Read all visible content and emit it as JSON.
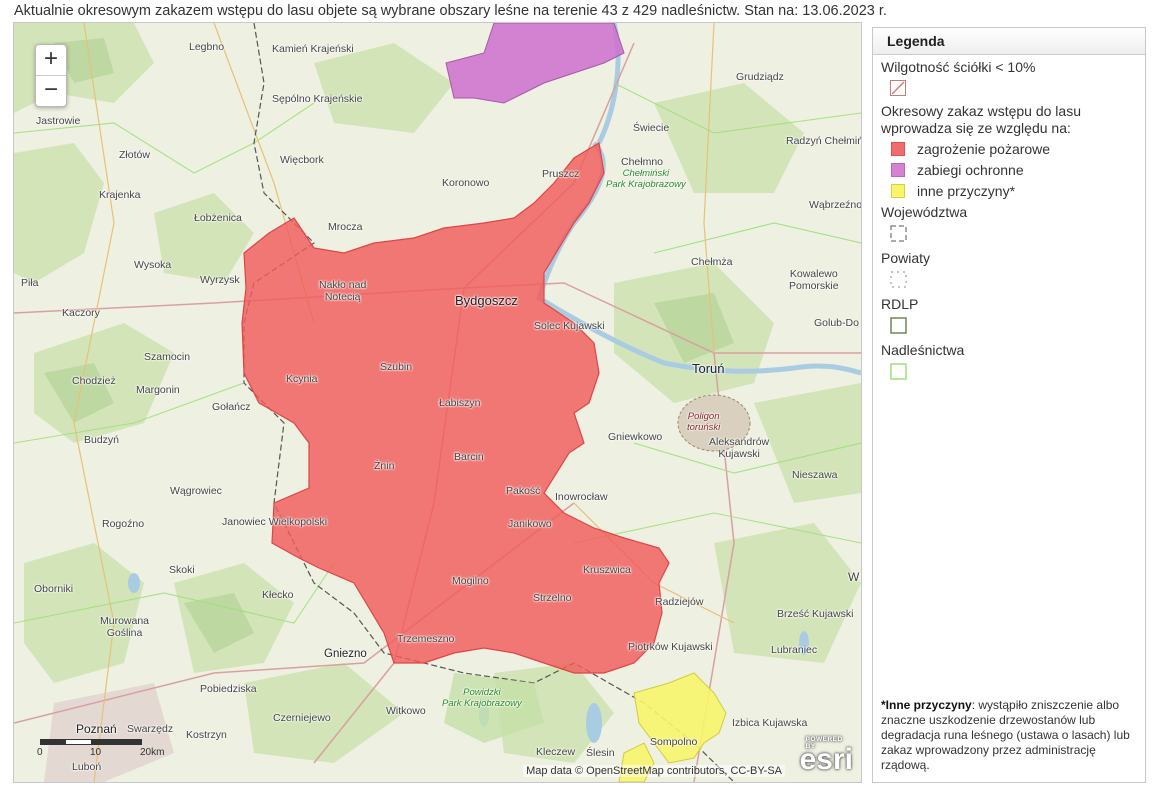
{
  "header": {
    "text": "Aktualnie okresowym zakazem wstępu do lasu objete są wybrane obszary leśne na terenie 43 z 429 nadleśnictw. Stan na: 13.06.2023 r."
  },
  "map": {
    "zoom_in": "+",
    "zoom_out": "−",
    "places": {
      "legbno": "Legbno",
      "kamien": "Kamień Krajeński",
      "sepolno": "Sępólno Krajeńskie",
      "jastrowie": "Jastrowie",
      "wiecbork": "Więcbork",
      "zlotow": "Złotów",
      "krajenka": "Krajenka",
      "lobzenica": "Łobżenica",
      "koronowo": "Koronowo",
      "mrocza": "Mrocza",
      "wysoka": "Wysoka",
      "wyrzysk": "Wyrzysk",
      "pila": "Piła",
      "kaczory": "Kaczory",
      "naklo": "Nakło nad\nNotecią",
      "bydgoszcz": "Bydgoszcz",
      "pruszcz": "Pruszcz",
      "grudziadz": "Grudziądz",
      "swiecie": "Świecie",
      "chelmno": "Chełmno",
      "radzyn": "Radzyń Chełmiński",
      "wabrzezno": "Wąbrzeźno",
      "chelmza": "Chełmża",
      "kowalewo": "Kowalewo\nPomorskie",
      "golub": "Golub-Do",
      "solec": "Solec Kujawski",
      "torun": "Toruń",
      "szamocin": "Szamocin",
      "chodziez": "Chodzież",
      "margonin": "Margonin",
      "kcynia": "Kcynia",
      "szubin": "Szubin",
      "labiszyn": "Łabiszyn",
      "golancz": "Gołańcz",
      "gniewkowo": "Gniewkowo",
      "aleksandrow": "Aleksandrów\nKujawski",
      "budzyn": "Budzyń",
      "barcin": "Barcin",
      "znin": "Żnin",
      "niezawa": "Nieszawa",
      "wagrowiec": "Wągrowiec",
      "pakosc": "Pakość",
      "inowroclaw": "Inowrocław",
      "janowiec": "Janowiec Wielkopolski",
      "janikowo": "Janikowo",
      "rogozno": "Rogoźno",
      "kruszwica": "Kruszwica",
      "skoki": "Skoki",
      "mogilno": "Mogilno",
      "oborniki": "Oborniki",
      "klecko": "Kłecko",
      "strzelno": "Strzelno",
      "radziejow": "Radziejów",
      "brzesc": "Brześć Kujawski",
      "murowana": "Murowana\nGoślina",
      "trzemeszno": "Trzemeszno",
      "piotrkow": "Piotrków Kujawski",
      "lubraniec": "Lubraniec",
      "gniezno": "Gniezno",
      "pobiedziska": "Pobiedziska",
      "witkowo": "Witkowo",
      "czerniejewo": "Czerniejewo",
      "izbica": "Izbica Kujawska",
      "poznan": "Poznań",
      "swarzedz": "Swarzędz",
      "kostrzyn": "Kostrzyn",
      "sompolno": "Sompolno",
      "kleczew": "Kleczew",
      "slesin": "Ślesin",
      "lubon": "Luboń",
      "w": "W"
    },
    "parks": {
      "chelminski": "Chełmiński\nPark Krajobrazowy",
      "powidzki": "Powidzki\nPark Krajobrazowy"
    },
    "military": "Poligon\ntoruński",
    "scale_0": "0",
    "scale_10": "10",
    "scale_20": "20km",
    "attribution": "Map data © OpenStreetMap contributors, CC-BY-SA",
    "esri_powered": "POWERED BY",
    "esri_logo": "esri"
  },
  "legend": {
    "title": "Legenda",
    "moisture": "Wilgotność ściółki < 10%",
    "ban_intro": "Okresowy zakaz wstępu do lasu wprowadza się ze względu na:",
    "items": [
      {
        "label": "zagrożenie pożarowe",
        "color": "#f06b6b"
      },
      {
        "label": "zabiegi ochronne",
        "color": "#d583d1"
      },
      {
        "label": "inne przyczyny*",
        "color": "#f7f56b"
      }
    ],
    "voivodeships": "Województwa",
    "counties": "Powiaty",
    "rdlp": "RDLP",
    "rdlp_color": "#6e8a56",
    "districts": "Nadleśnictwa",
    "districts_color": "#9ee07a",
    "note_bold": "*Inne przyczyny",
    "note_text": ": wystąpiło zniszczenie albo znaczne uszkodzenie drzewostanów lub degradacja runa leśnego (ustawa o lasach) lub zakaz wprowadzony przez administrację rządową."
  }
}
